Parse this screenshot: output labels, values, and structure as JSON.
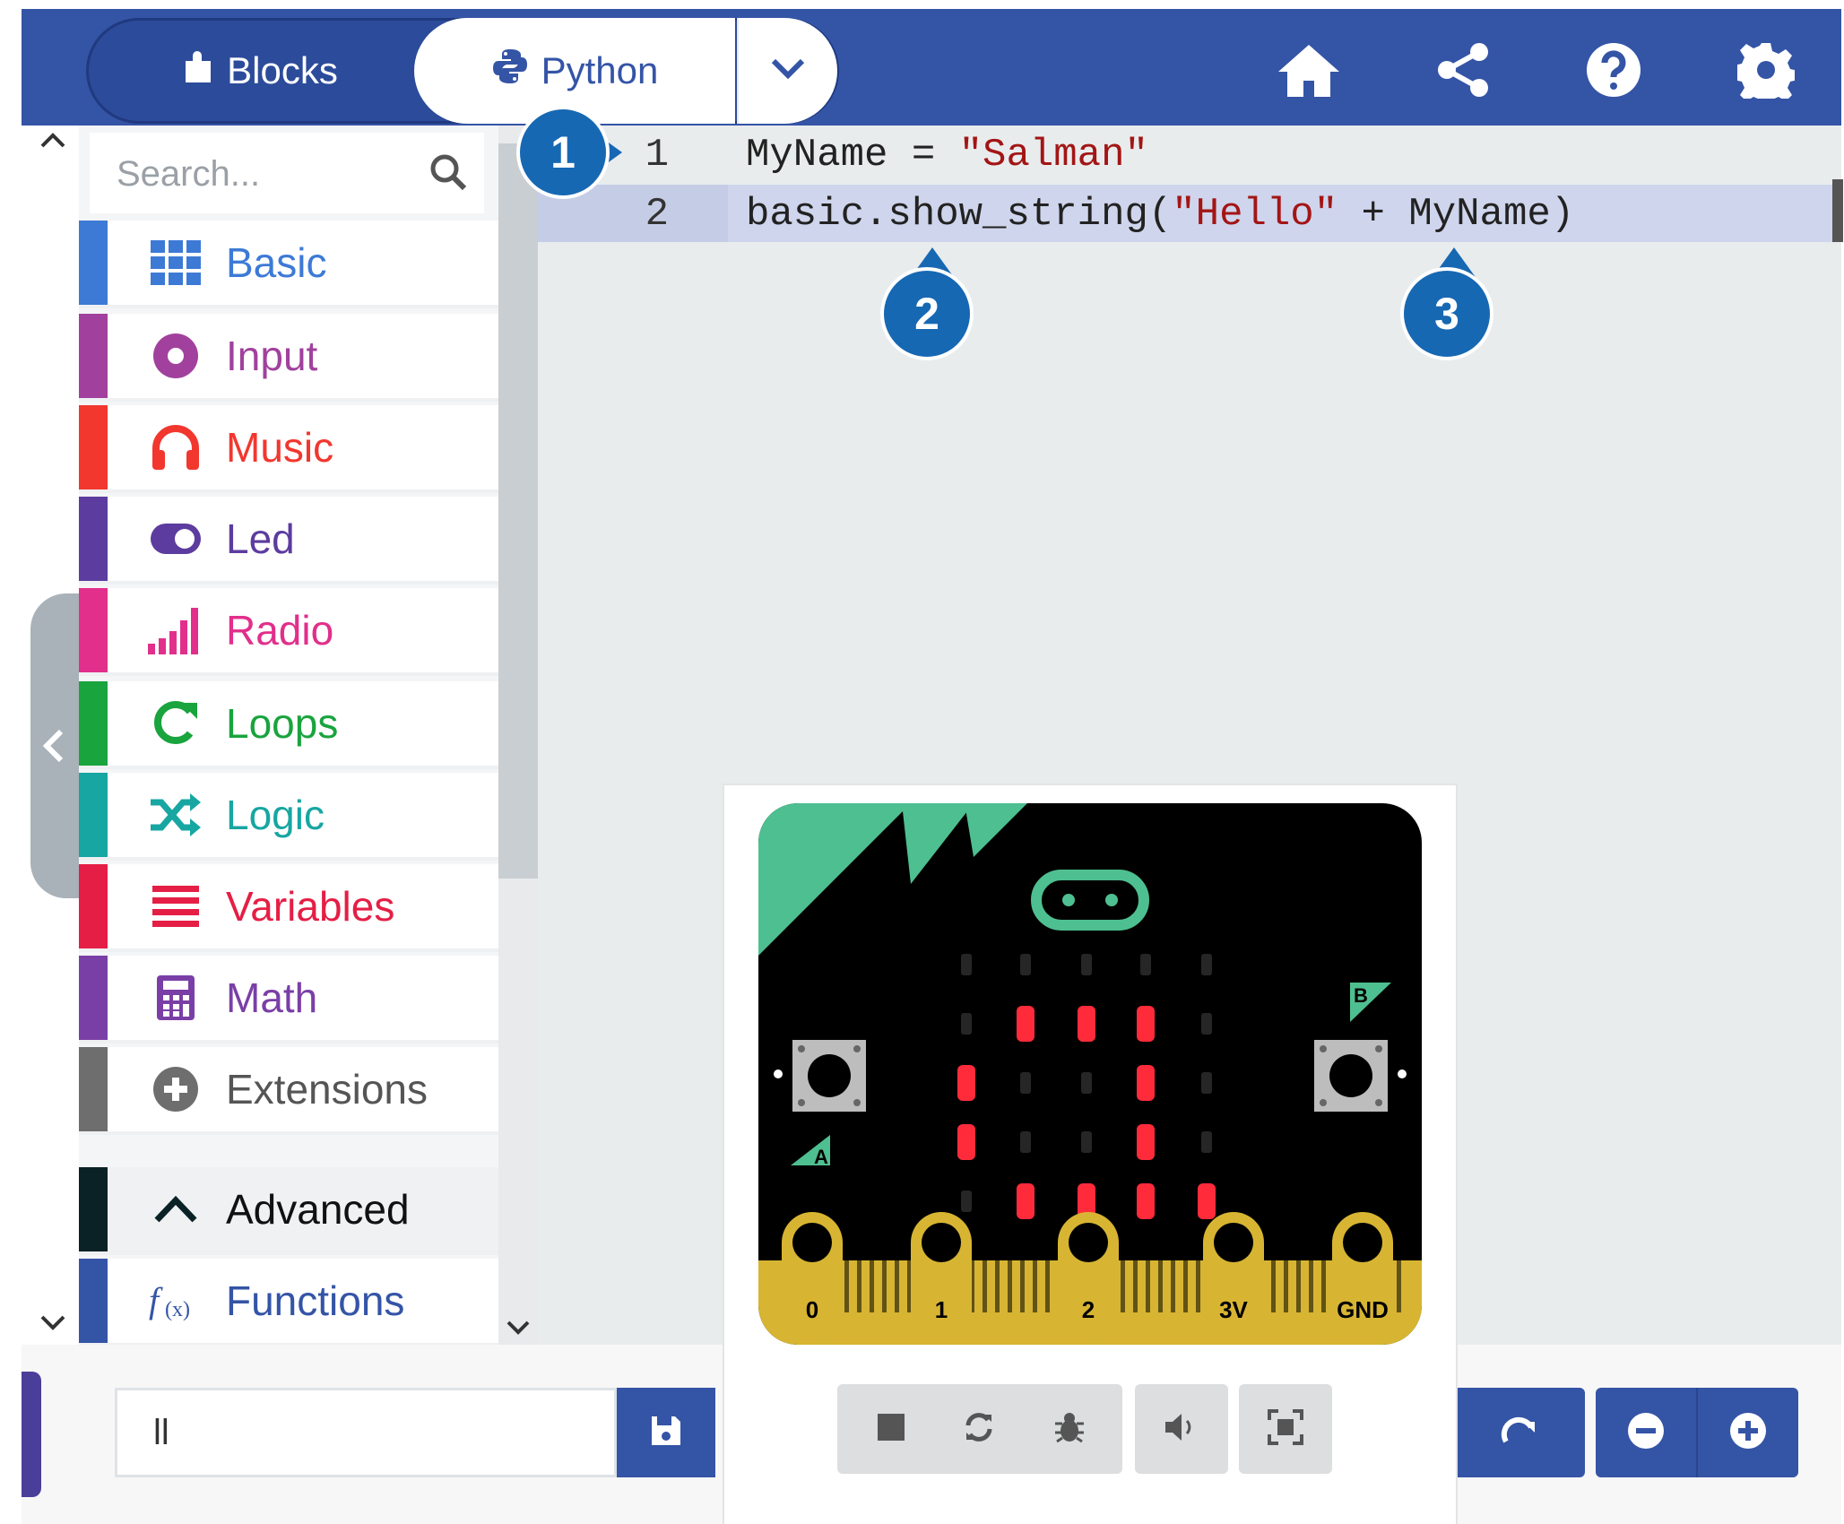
{
  "header": {
    "tabs": [
      {
        "label": "Blocks",
        "icon": "puzzle-icon"
      },
      {
        "label": "Python",
        "icon": "python-icon"
      }
    ],
    "dropdown_icon": "chevron-down-icon",
    "actions": [
      "home-icon",
      "share-icon",
      "help-icon",
      "settings-icon"
    ],
    "colors": {
      "bar": "#3454a6",
      "active_tab_text": "#3454a6"
    }
  },
  "toolbox": {
    "search_placeholder": "Search...",
    "categories": [
      {
        "label": "Basic",
        "color": "#3d7ad6",
        "icon": "grid-icon"
      },
      {
        "label": "Input",
        "color": "#a1419d",
        "icon": "input-circle-icon"
      },
      {
        "label": "Music",
        "color": "#f2372e",
        "icon": "headphones-icon"
      },
      {
        "label": "Led",
        "color": "#5c3c9e",
        "icon": "toggle-icon"
      },
      {
        "label": "Radio",
        "color": "#e12f8b",
        "icon": "signal-bars-icon"
      },
      {
        "label": "Loops",
        "color": "#19a43e",
        "icon": "loop-arrow-icon"
      },
      {
        "label": "Logic",
        "color": "#17a6a2",
        "icon": "shuffle-icon"
      },
      {
        "label": "Variables",
        "color": "#e51e45",
        "icon": "lines-icon"
      },
      {
        "label": "Math",
        "color": "#7a3fa6",
        "icon": "calculator-icon"
      },
      {
        "label": "Extensions",
        "color": "#6e6e6e",
        "icon": "plus-circle-icon"
      },
      {
        "label": "Advanced",
        "color": "#0a2226",
        "icon": "chevron-up-icon"
      },
      {
        "label": "Functions",
        "color": "#3454a6",
        "icon": "function-icon"
      }
    ]
  },
  "editor": {
    "lines": [
      {
        "number": "1",
        "text_a": "MyName = ",
        "string": "\"Salman\"",
        "text_b": ""
      },
      {
        "number": "2",
        "text_a": "basic.show_string(",
        "string": "\"Hello\"",
        "text_b": " + MyName)"
      }
    ]
  },
  "callouts": [
    "1",
    "2",
    "3"
  ],
  "simulator": {
    "pins": [
      "0",
      "1",
      "2",
      "3V",
      "GND"
    ],
    "button_a": "A",
    "button_b": "B",
    "controls": [
      "stop-icon",
      "restart-icon",
      "debug-icon",
      "sound-icon",
      "fullscreen-icon"
    ],
    "led_color": "#ff2b3a"
  },
  "bottombar": {
    "project_name": "ll",
    "buttons": [
      "save-icon",
      "redo-icon",
      "zoom-out-icon",
      "zoom-in-icon"
    ]
  }
}
